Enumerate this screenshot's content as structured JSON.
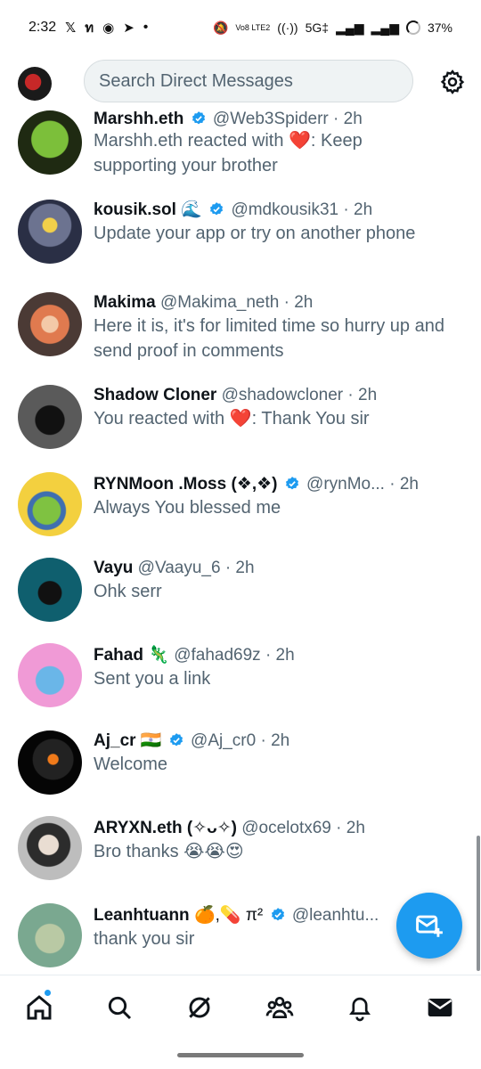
{
  "status_bar": {
    "time": "2:32",
    "indicators": [
      "x-logo",
      "n-icon",
      "record-icon",
      "telegram-icon"
    ],
    "dot": "•",
    "network": "Vo8 LTE2",
    "signal_label": "5G‡",
    "battery": "37%"
  },
  "header": {
    "search_placeholder": "Search Direct Messages"
  },
  "conversations": [
    {
      "name": "Marshh.eth",
      "verified": true,
      "emoji": "",
      "handle": "@Web3Spiderr",
      "time": "· 2h",
      "message_pre": "Marshh.eth reacted with ",
      "reaction": "❤️",
      "message_post": ": Keep supporting your brother"
    },
    {
      "name": "kousik.sol",
      "verified": true,
      "emoji": "🌊",
      "handle": "@mdkousik31",
      "time": "· 2h",
      "message_pre": "Update your app or try on another phone",
      "reaction": "",
      "message_post": ""
    },
    {
      "name": "Makima",
      "verified": false,
      "emoji": "",
      "handle": "@Makima_neth",
      "time": "· 2h",
      "message_pre": "Here it is, it's for limited time so hurry up and send proof in comments",
      "reaction": "",
      "message_post": ""
    },
    {
      "name": "Shadow Cloner",
      "verified": false,
      "emoji": "",
      "handle": "@shadowcloner",
      "time": "· 2h",
      "message_pre": "You reacted with ",
      "reaction": "❤️",
      "message_post": ": Thank You sir"
    },
    {
      "name": "RYNMoon .Moss (❖,❖)",
      "verified": true,
      "emoji": "",
      "handle": "@rynMo...",
      "time": "· 2h",
      "message_pre": "Always  You blessed me",
      "reaction": "",
      "message_post": ""
    },
    {
      "name": "Vayu",
      "verified": false,
      "emoji": "",
      "handle": "@Vaayu_6",
      "time": "· 2h",
      "message_pre": "Ohk serr",
      "reaction": "",
      "message_post": ""
    },
    {
      "name": "Fahad",
      "verified": false,
      "emoji": "🦎",
      "handle": "@fahad69z",
      "time": "· 2h",
      "message_pre": "Sent you a link",
      "reaction": "",
      "message_post": ""
    },
    {
      "name": "Aj_cr",
      "verified": true,
      "emoji": "🇮🇳",
      "handle": "@Aj_cr0",
      "time": "· 2h",
      "message_pre": "Welcome",
      "reaction": "",
      "message_post": ""
    },
    {
      "name": "ARYXN.eth (✧ᴗ✧)",
      "verified": false,
      "emoji": "",
      "handle": "@ocelotx69",
      "time": "· 2h",
      "message_pre": "Bro thanks 😭😭😍",
      "reaction": "",
      "message_post": ""
    },
    {
      "name": "Leanhtuann",
      "verified": true,
      "emoji": "🍊,💊 π²",
      "handle": "@leanhtu...",
      "time": "",
      "message_pre": "thank you sir",
      "reaction": "",
      "message_post": ""
    }
  ],
  "nav": [
    "home-icon",
    "search-icon",
    "grok-icon",
    "communities-icon",
    "notifications-icon",
    "messages-icon"
  ],
  "colors": {
    "accent": "#1d9bf0",
    "secondary_text": "#536471",
    "heart": "#e0245e"
  }
}
